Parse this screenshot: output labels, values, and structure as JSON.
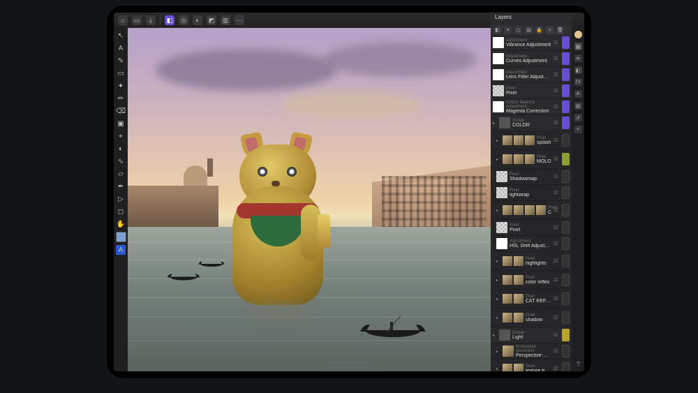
{
  "topbar": {
    "buttons": [
      {
        "name": "home-icon",
        "glyph": "⌂"
      },
      {
        "name": "document-icon",
        "glyph": "▭"
      },
      {
        "name": "export-icon",
        "glyph": "⤓"
      },
      {
        "name": "sep"
      },
      {
        "name": "pixel-persona-icon",
        "glyph": "◧",
        "active": true
      },
      {
        "name": "liquify-persona-icon",
        "glyph": "◎"
      },
      {
        "name": "develop-persona-icon",
        "glyph": "◐"
      },
      {
        "name": "tone-persona-icon",
        "glyph": "◩"
      },
      {
        "name": "export-persona-icon",
        "glyph": "▥"
      },
      {
        "name": "more-icon",
        "glyph": "⋯"
      }
    ]
  },
  "tools": [
    {
      "name": "move-tool",
      "glyph": "↖"
    },
    {
      "name": "art-text-tool",
      "glyph": "A"
    },
    {
      "name": "selection-brush-tool",
      "glyph": "✎"
    },
    {
      "name": "marquee-tool",
      "glyph": "▭"
    },
    {
      "name": "flood-select-tool",
      "glyph": "✦"
    },
    {
      "name": "paint-brush-tool",
      "glyph": "✏"
    },
    {
      "name": "erase-tool",
      "glyph": "⌫"
    },
    {
      "name": "fill-tool",
      "glyph": "▣"
    },
    {
      "name": "clone-tool",
      "glyph": "⌖"
    },
    {
      "name": "dodge-tool",
      "glyph": "◐"
    },
    {
      "name": "smudge-tool",
      "glyph": "∿"
    },
    {
      "name": "crop-tool",
      "glyph": "▱"
    },
    {
      "name": "pen-tool",
      "glyph": "✒"
    },
    {
      "name": "node-tool",
      "glyph": "▷"
    },
    {
      "name": "shape-tool",
      "glyph": "◻"
    },
    {
      "name": "view-tool",
      "glyph": "✋"
    }
  ],
  "swatches": {
    "fg": "#7aa0d4",
    "bg": "#1a1a1a"
  },
  "studio": [
    {
      "name": "color-studio",
      "shape": "dot",
      "color": "#e4c592"
    },
    {
      "name": "swatches-studio",
      "shape": "sq",
      "glyph": "▦"
    },
    {
      "name": "brushes-studio",
      "shape": "sq",
      "glyph": "≋"
    },
    {
      "name": "adjustments-studio",
      "shape": "sq",
      "glyph": "◧"
    },
    {
      "name": "fx-studio",
      "shape": "sq",
      "glyph": "ƒx"
    },
    {
      "name": "text-studio",
      "shape": "sq",
      "glyph": "A"
    },
    {
      "name": "channels-studio",
      "shape": "sq",
      "glyph": "▤"
    },
    {
      "name": "history-studio",
      "shape": "sq",
      "glyph": "↺"
    },
    {
      "name": "navigator-studio",
      "shape": "sq",
      "glyph": "⌖"
    }
  ],
  "layers_panel": {
    "title": "Layers",
    "toolbar": [
      "opacity-icon",
      "blend-icon",
      "mask-icon",
      "flatten-icon",
      "lock-icon",
      "add-icon",
      "delete-icon"
    ]
  },
  "layers": [
    {
      "id": "l1",
      "type": "Adjustment",
      "name": "Vibrance Adjustment",
      "tag": "purple",
      "thumbs": [
        "mask"
      ]
    },
    {
      "id": "l2",
      "type": "Adjustment",
      "name": "Curves Adjustment",
      "tag": "purple",
      "thumbs": [
        "mask"
      ]
    },
    {
      "id": "l3",
      "type": "Adjustment",
      "name": "Lens Filter Adjustment",
      "tag": "purple",
      "thumbs": [
        "mask"
      ]
    },
    {
      "id": "l4",
      "type": "Pixel",
      "name": "Pixel",
      "tag": "purple",
      "thumbs": [
        "checker"
      ]
    },
    {
      "id": "l5",
      "type": "Colour Balance Adjustment",
      "name": "Magenta Correction",
      "tag": "purple",
      "thumbs": [
        "mask"
      ]
    },
    {
      "id": "l6",
      "type": "Group",
      "name": "COLOR",
      "tag": "purple",
      "thumbs": [
        "folder"
      ],
      "arrow": true
    },
    {
      "id": "l7",
      "type": "Pixel",
      "name": "splash",
      "tag": "none",
      "sub": true,
      "thumbs": [
        "img",
        "img",
        "img"
      ],
      "arrow": true
    },
    {
      "id": "l8",
      "type": "Pixel",
      "name": "MOLO",
      "tag": "green",
      "sub": true,
      "thumbs": [
        "img",
        "img",
        "img"
      ],
      "arrow": true
    },
    {
      "id": "l9",
      "type": "Pixel",
      "name": "Shadowmap",
      "tag": "none",
      "sub": true,
      "thumbs": [
        "checker"
      ]
    },
    {
      "id": "l10",
      "type": "Pixel",
      "name": "lightwrap",
      "tag": "none",
      "sub": true,
      "thumbs": [
        "checker"
      ]
    },
    {
      "id": "l11",
      "type": "Pixel",
      "name": "CAT",
      "tag": "none",
      "sub": true,
      "thumbs": [
        "img",
        "img",
        "img",
        "img"
      ],
      "arrow": true
    },
    {
      "id": "l12",
      "type": "Pixel",
      "name": "Pixel",
      "tag": "none",
      "sub": true,
      "thumbs": [
        "checker"
      ]
    },
    {
      "id": "l13",
      "type": "Adjustment",
      "name": "HSL Shift Adjustment",
      "tag": "none",
      "sub": true,
      "thumbs": [
        "mask"
      ]
    },
    {
      "id": "l14",
      "type": "Pixel",
      "name": "highlights",
      "tag": "none",
      "sub": true,
      "thumbs": [
        "img",
        "img"
      ],
      "arrow": true
    },
    {
      "id": "l15",
      "type": "Pixel",
      "name": "color reflex",
      "tag": "none",
      "sub": true,
      "thumbs": [
        "img",
        "img"
      ],
      "arrow": true
    },
    {
      "id": "l16",
      "type": "Pixel",
      "name": "CAT REFLECTION",
      "tag": "none",
      "sub": true,
      "thumbs": [
        "img",
        "img"
      ],
      "arrow": true
    },
    {
      "id": "l17",
      "type": "Pixel",
      "name": "shadow",
      "tag": "none",
      "sub": true,
      "thumbs": [
        "img",
        "img"
      ],
      "arrow": true
    },
    {
      "id": "l18",
      "type": "Group",
      "name": "Light",
      "tag": "yellow",
      "thumbs": [
        "folder"
      ],
      "arrow": true
    },
    {
      "id": "l19",
      "type": "Embedded document",
      "name": "Perspective-Grid",
      "tag": "none",
      "sub": true,
      "thumbs": [
        "img"
      ],
      "arrow": true
    },
    {
      "id": "l20",
      "type": "Pixel",
      "name": "texture traffic lights",
      "tag": "none",
      "sub": true,
      "thumbs": [
        "img",
        "img"
      ],
      "arrow": true
    }
  ],
  "help": "?"
}
